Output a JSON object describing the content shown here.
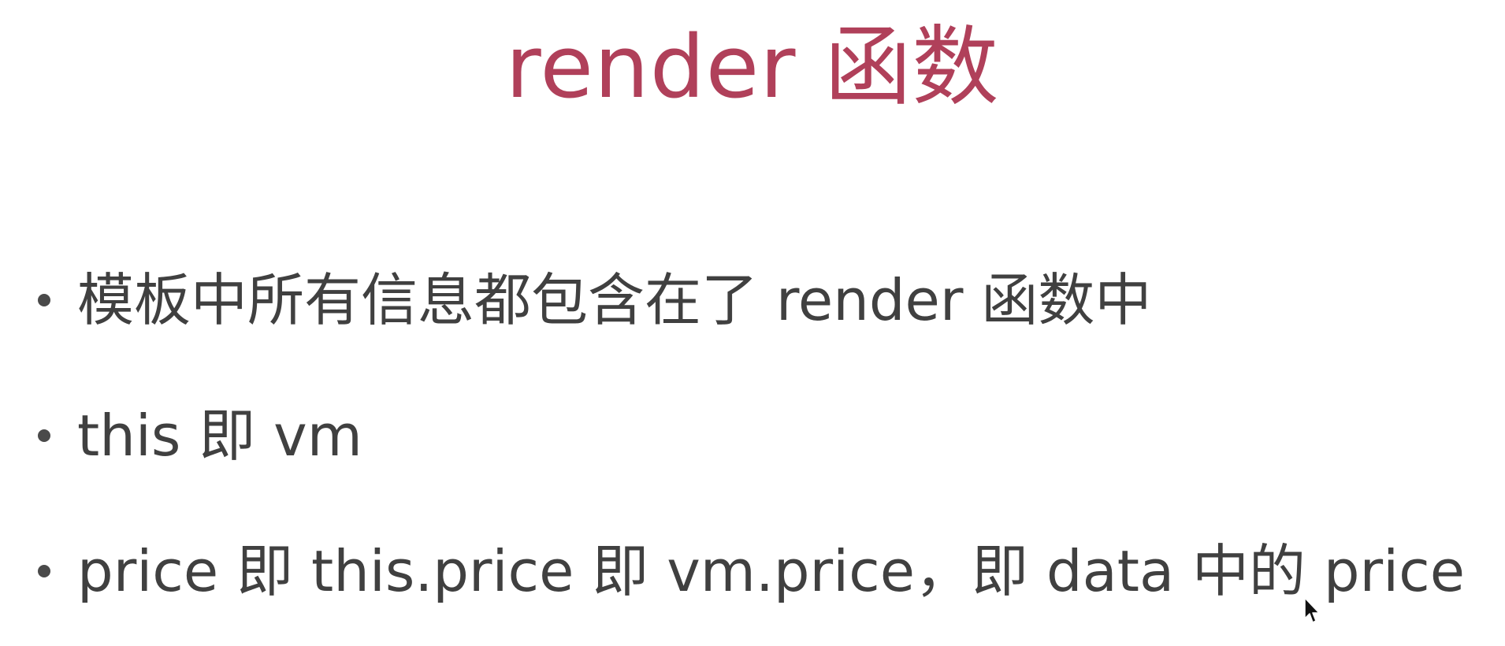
{
  "slide": {
    "title": "render 函数",
    "title_color": "#b0405a",
    "text_color": "#404040",
    "bullets": [
      {
        "text": "模板中所有信息都包含在了 render 函数中"
      },
      {
        "text": "this 即 vm"
      },
      {
        "text": "price 即 this.price 即 vm.price，即 data 中的 price"
      }
    ]
  },
  "icons": {
    "cursor": "mouse-pointer-icon",
    "bullet": "bullet-dot-icon"
  }
}
